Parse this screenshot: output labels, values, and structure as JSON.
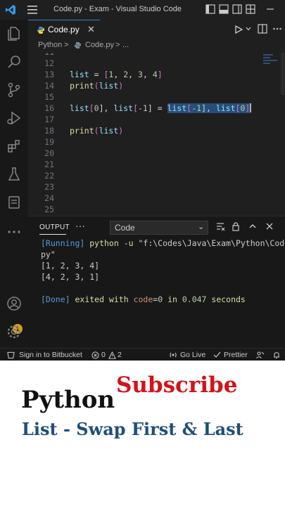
{
  "window": {
    "title": "Code.py - Exam - Visual Studio Code",
    "badge_count": "1"
  },
  "tabs": [
    {
      "label": "Code.py",
      "close": "✕"
    }
  ],
  "breadcrumb": {
    "part1": "Python",
    "sep1": ">",
    "part2": "Code.py",
    "sep2": ">",
    "part3": "..."
  },
  "editor": {
    "lines": [
      {
        "n": "11"
      },
      {
        "n": "12"
      },
      {
        "n": "13"
      },
      {
        "n": "14"
      },
      {
        "n": "15"
      },
      {
        "n": "16"
      },
      {
        "n": "17"
      },
      {
        "n": "18"
      },
      {
        "n": "19"
      },
      {
        "n": "20"
      },
      {
        "n": "21"
      },
      {
        "n": "22"
      },
      {
        "n": "23"
      },
      {
        "n": "24"
      },
      {
        "n": "25"
      }
    ],
    "code": {
      "l13": {
        "a": "list",
        "b": " = ",
        "c": "[",
        "d": "1",
        "e": ", ",
        "f": "2",
        "g": ", ",
        "h": "3",
        "i": ", ",
        "j": "4",
        "k": "]"
      },
      "l14": {
        "fn": "print",
        "p1": "(",
        "arg": "list",
        "p2": ")"
      },
      "l16": {
        "a": "list",
        "b": "[",
        "c": "0",
        "d": "], ",
        "e": "list",
        "f": "[",
        "g": "-1",
        "h": "] = ",
        "i": "list",
        "j": "[",
        "k": "-1",
        "l": "],",
        "m": " list",
        "n": "[",
        "o": "0",
        "p": "]"
      },
      "l18": {
        "fn": "print",
        "p1": "(",
        "arg": "list",
        "p2": ")"
      }
    }
  },
  "panel": {
    "tab_label": "OUTPUT",
    "more": "···",
    "select_value": "Code",
    "select_chevron": "⌄",
    "output": {
      "l1_a": "[Running]",
      "l1_b": " python -u ",
      "l1_c": "\"f:\\Codes\\Java\\Exam\\Python\\Code.",
      "l2": "py\"",
      "l3": "[1, 2, 3, 4]",
      "l4": "[4, 2, 3, 1]",
      "l6_a": "[Done]",
      "l6_b": " exited with ",
      "l6_c": "code",
      "l6_d": "=",
      "l6_e": "0",
      "l6_f": " in ",
      "l6_g": "0.047",
      "l6_h": " seconds"
    }
  },
  "status": {
    "bitbucket": "Sign in to Bitbucket",
    "errors": "0",
    "warnings": "2",
    "golive": "Go Live",
    "prettier": "Prettier"
  },
  "caption": {
    "subscribe": "Subscribe",
    "title": "Python",
    "subtitle": "List - Swap First & Last"
  },
  "colors": {
    "accent_blue": "#2f7fd6",
    "subscribe_red": "#d4121a",
    "subtitle_blue": "#1f4e79"
  }
}
